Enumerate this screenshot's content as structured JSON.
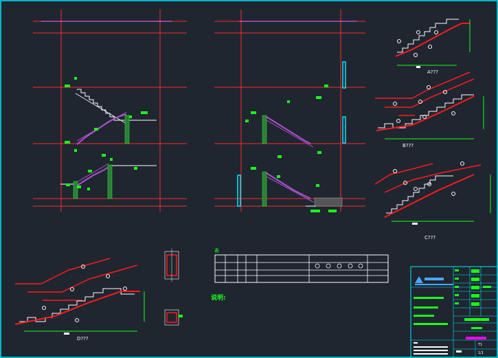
{
  "drawing": {
    "section_labels": [
      "A???",
      "B???",
      "C???",
      "D???"
    ],
    "notes_label": "说明:",
    "table_symbol": "表",
    "title_block": {
      "logo_text": "LOGO",
      "company_line": "",
      "row_text_1": "",
      "row_text_2": "",
      "row_text_3": "",
      "footer_a": "T1",
      "footer_b": "1/1"
    }
  },
  "colors": {
    "background": "#1f2630",
    "frame": "#00e5ff",
    "grid": "#ff2a2a",
    "stair": "#ffffff",
    "rebar": "#ff1a1a",
    "tag": "#19ff19",
    "railing": "#b04fd1",
    "column": "#2f7d3b",
    "accent": "#ff00ff"
  }
}
